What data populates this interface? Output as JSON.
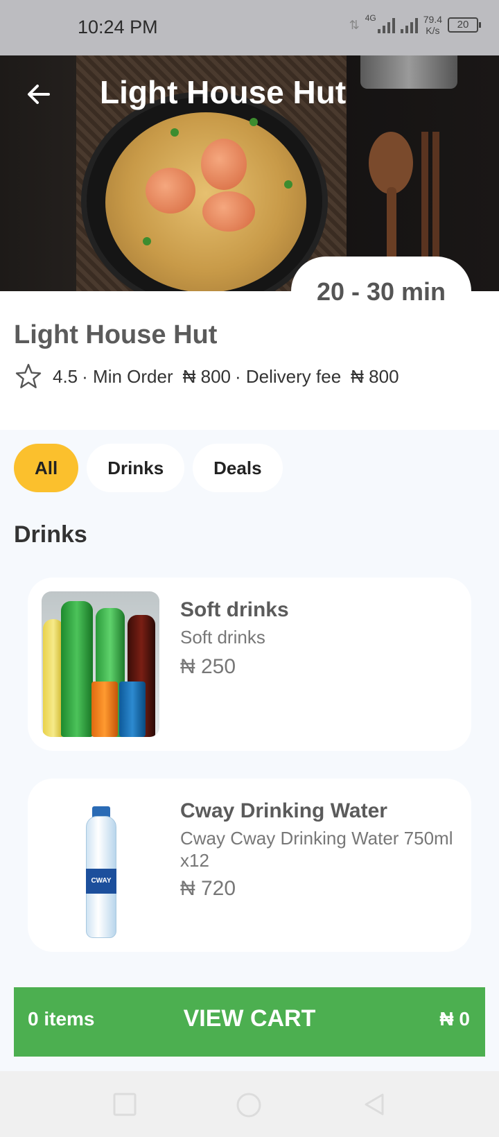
{
  "status_bar": {
    "time": "10:24 PM",
    "network": "4G",
    "speed_value": "79.4",
    "speed_unit": "K/s",
    "battery": "20"
  },
  "header": {
    "title": "Light House Hut",
    "back_icon": "arrow-left-icon"
  },
  "hero": {
    "delivery_time": "20 - 30 min"
  },
  "restaurant": {
    "name": "Light House Hut",
    "rating": "4.5",
    "min_order_label": "· Min Order",
    "min_order_value": "₦ 800",
    "delivery_fee_label": "· Delivery fee",
    "delivery_fee_value": "₦ 800"
  },
  "filters": {
    "items": [
      {
        "label": "All",
        "active": true
      },
      {
        "label": "Drinks",
        "active": false
      },
      {
        "label": "Deals",
        "active": false
      }
    ],
    "active_color": "#fbc02d"
  },
  "section": {
    "title": "Drinks"
  },
  "products": [
    {
      "name": "Soft drinks",
      "description": "Soft drinks",
      "price": "₦ 250"
    },
    {
      "name": "Cway Drinking Water",
      "description": "Cway Cway Drinking Water 750ml x12",
      "price": "₦ 720"
    }
  ],
  "cart": {
    "items_count": "0 items",
    "label": "VIEW CART",
    "total": "₦ 0",
    "color": "#4caf50"
  }
}
